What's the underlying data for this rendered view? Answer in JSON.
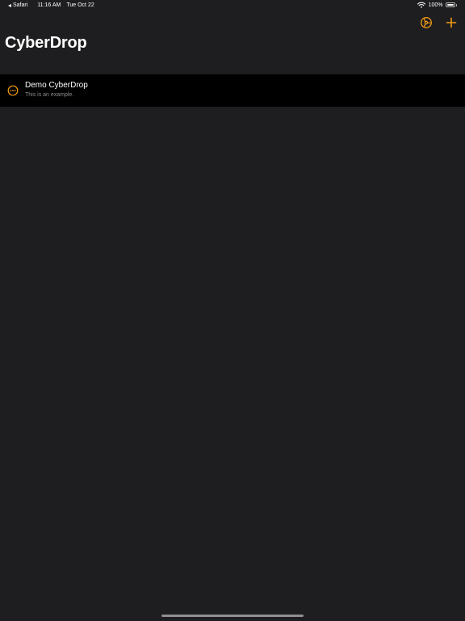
{
  "status_bar": {
    "back_app": "Safari",
    "time": "11:16 AM",
    "date": "Tue Oct 22",
    "battery_text": "100%",
    "battery_level": 1.0,
    "icons": [
      "back-caret-icon",
      "wifi-icon",
      "battery-icon"
    ]
  },
  "nav": {
    "settings_icon": "gear-icon",
    "add_icon": "plus-icon"
  },
  "page": {
    "title": "CyberDrop"
  },
  "drops": [
    {
      "title": "Demo CyberDrop",
      "subtitle": "This is an example.",
      "icon": "ellipsis-circle-icon"
    }
  ],
  "colors": {
    "accent": "#f39c12",
    "background": "#1e1e20",
    "row_background": "#000000",
    "secondary_text": "#8d8d92"
  }
}
